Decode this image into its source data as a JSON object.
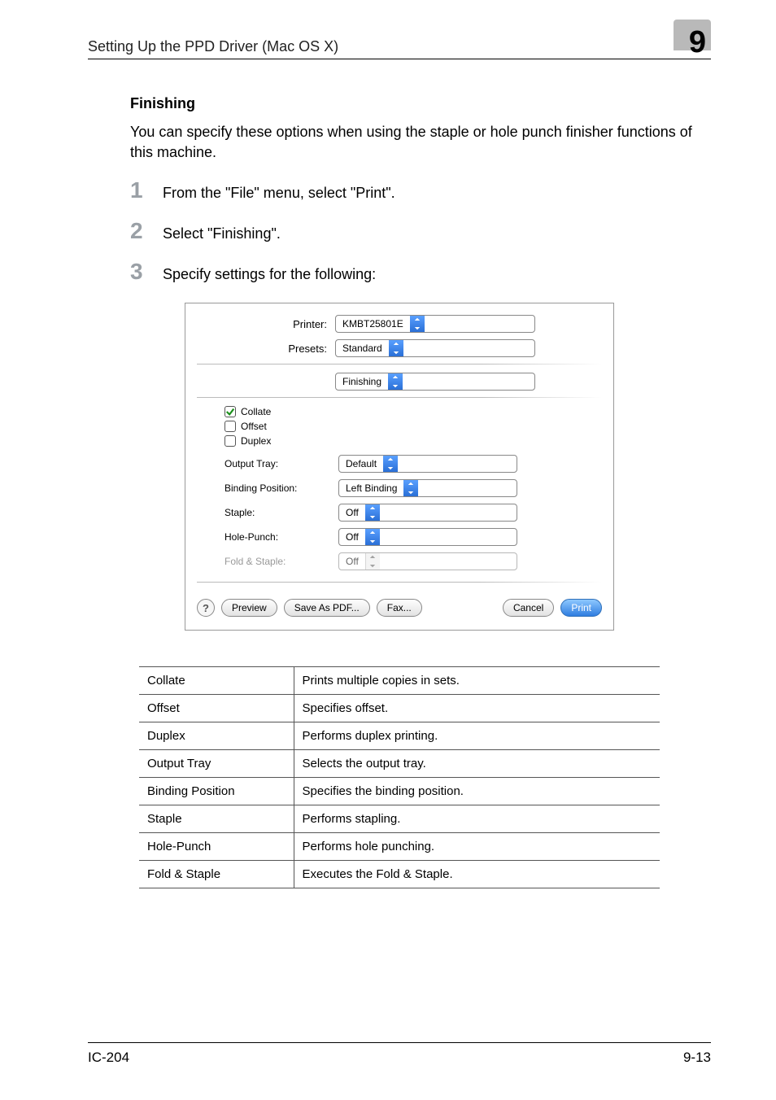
{
  "header": {
    "left": "Setting Up the PPD Driver (Mac OS X)",
    "chapter": "9"
  },
  "section": {
    "title": "Finishing",
    "intro": "You can specify these options when using the staple or hole punch finisher functions of this machine."
  },
  "steps": [
    {
      "num": "1",
      "text": "From the \"File\" menu, select \"Print\"."
    },
    {
      "num": "2",
      "text": "Select \"Finishing\"."
    },
    {
      "num": "3",
      "text": "Specify settings for the following:"
    }
  ],
  "dialog": {
    "printer_label": "Printer:",
    "printer_value": "KMBT25801E",
    "presets_label": "Presets:",
    "presets_value": "Standard",
    "pane_value": "Finishing",
    "checks": {
      "collate": {
        "label": "Collate",
        "checked": true
      },
      "offset": {
        "label": "Offset",
        "checked": false
      },
      "duplex": {
        "label": "Duplex",
        "checked": false
      }
    },
    "options": {
      "output_tray": {
        "label": "Output Tray:",
        "value": "Default"
      },
      "binding_position": {
        "label": "Binding Position:",
        "value": "Left Binding"
      },
      "staple": {
        "label": "Staple:",
        "value": "Off"
      },
      "hole_punch": {
        "label": "Hole-Punch:",
        "value": "Off"
      },
      "fold_staple": {
        "label": "Fold & Staple:",
        "value": "Off",
        "disabled": true
      }
    },
    "buttons": {
      "help": "?",
      "preview": "Preview",
      "save_pdf": "Save As PDF...",
      "fax": "Fax...",
      "cancel": "Cancel",
      "print": "Print"
    }
  },
  "defs": [
    {
      "term": "Collate",
      "desc": "Prints multiple copies in sets."
    },
    {
      "term": "Offset",
      "desc": "Specifies offset."
    },
    {
      "term": "Duplex",
      "desc": "Performs duplex printing."
    },
    {
      "term": "Output Tray",
      "desc": "Selects the output tray."
    },
    {
      "term": "Binding Position",
      "desc": "Specifies the binding position."
    },
    {
      "term": "Staple",
      "desc": "Performs stapling."
    },
    {
      "term": "Hole-Punch",
      "desc": "Performs hole punching."
    },
    {
      "term": "Fold & Staple",
      "desc": "Executes the Fold & Staple."
    }
  ],
  "footer": {
    "left": "IC-204",
    "right": "9-13"
  }
}
